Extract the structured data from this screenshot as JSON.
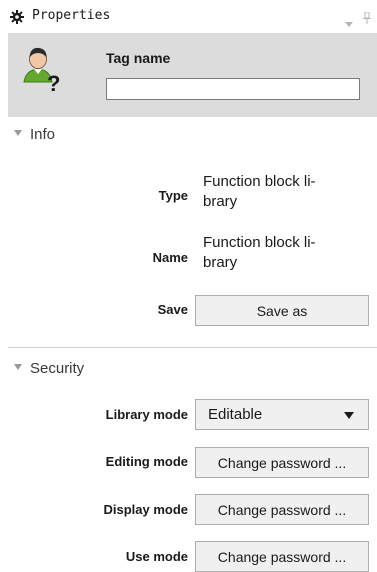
{
  "panel": {
    "title": "Properties",
    "icons": {
      "title_icon": "gear-icon",
      "menu": "chevron-down-icon",
      "pin": "pin-icon"
    }
  },
  "header": {
    "avatar_icon": "user-unknown-icon",
    "tag_label": "Tag name",
    "tag_value": ""
  },
  "info": {
    "heading": "Info",
    "type_label": "Type",
    "type_value_line1": "Function block li-",
    "type_value_line2": "brary",
    "name_label": "Name",
    "name_value_line1": "Function block li-",
    "name_value_line2": "brary",
    "save_label": "Save",
    "save_button": "Save as"
  },
  "security": {
    "heading": "Security",
    "library_mode_label": "Library mode",
    "library_mode_value": "Editable",
    "editing_mode_label": "Editing mode",
    "editing_mode_button": "Change password ...",
    "display_mode_label": "Display mode",
    "display_mode_button": "Change password ...",
    "use_mode_label": "Use mode",
    "use_mode_button": "Change password ..."
  },
  "colors": {
    "header_bg": "#dcdcdc",
    "button_bg": "#f0f0f0",
    "button_border": "#adadad",
    "divider": "#cfcfcf"
  }
}
